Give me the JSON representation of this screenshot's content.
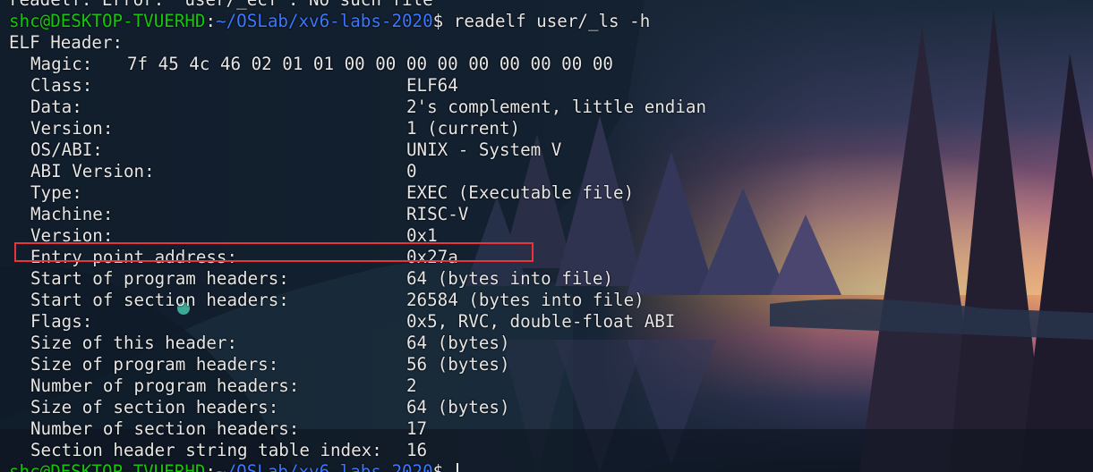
{
  "terminal": {
    "top_partial_line": "readelf: Error: 'user/_ecf': No such file",
    "prompt": {
      "user_host": "shc@DESKTOP-TVUERHD",
      "separator": ":",
      "path": "~/OSLab/xv6-labs-2020",
      "symbol": "$ "
    },
    "command": "readelf user/_ls -h",
    "header_title": "ELF Header:",
    "magic": {
      "label": "Magic:",
      "value": "7f 45 4c 46 02 01 01 00 00 00 00 00 00 00 00 00"
    },
    "fields": [
      {
        "label": "Class:",
        "value": "ELF64"
      },
      {
        "label": "Data:",
        "value": "2's complement, little endian"
      },
      {
        "label": "Version:",
        "value": "1 (current)"
      },
      {
        "label": "OS/ABI:",
        "value": "UNIX - System V"
      },
      {
        "label": "ABI Version:",
        "value": "0"
      },
      {
        "label": "Type:",
        "value": "EXEC (Executable file)"
      },
      {
        "label": "Machine:",
        "value": "RISC-V"
      },
      {
        "label": "Version:",
        "value": "0x1"
      },
      {
        "label": "Entry point address:",
        "value": "0x27a"
      },
      {
        "label": "Start of program headers:",
        "value": "64 (bytes into file)"
      },
      {
        "label": "Start of section headers:",
        "value": "26584 (bytes into file)"
      },
      {
        "label": "Flags:",
        "value": "0x5, RVC, double-float ABI"
      },
      {
        "label": "Size of this header:",
        "value": "64 (bytes)"
      },
      {
        "label": "Size of program headers:",
        "value": "56 (bytes)"
      },
      {
        "label": "Number of program headers:",
        "value": "2"
      },
      {
        "label": "Size of section headers:",
        "value": "64 (bytes)"
      },
      {
        "label": "Number of section headers:",
        "value": "17"
      },
      {
        "label": "Section header string table index:",
        "value": "16"
      }
    ]
  },
  "colors": {
    "prompt_user": "#16c60c",
    "prompt_path": "#3b78ff",
    "text": "#e6e6e6",
    "highlight_box": "#e8343a"
  },
  "highlighted_field": "Entry point address:"
}
